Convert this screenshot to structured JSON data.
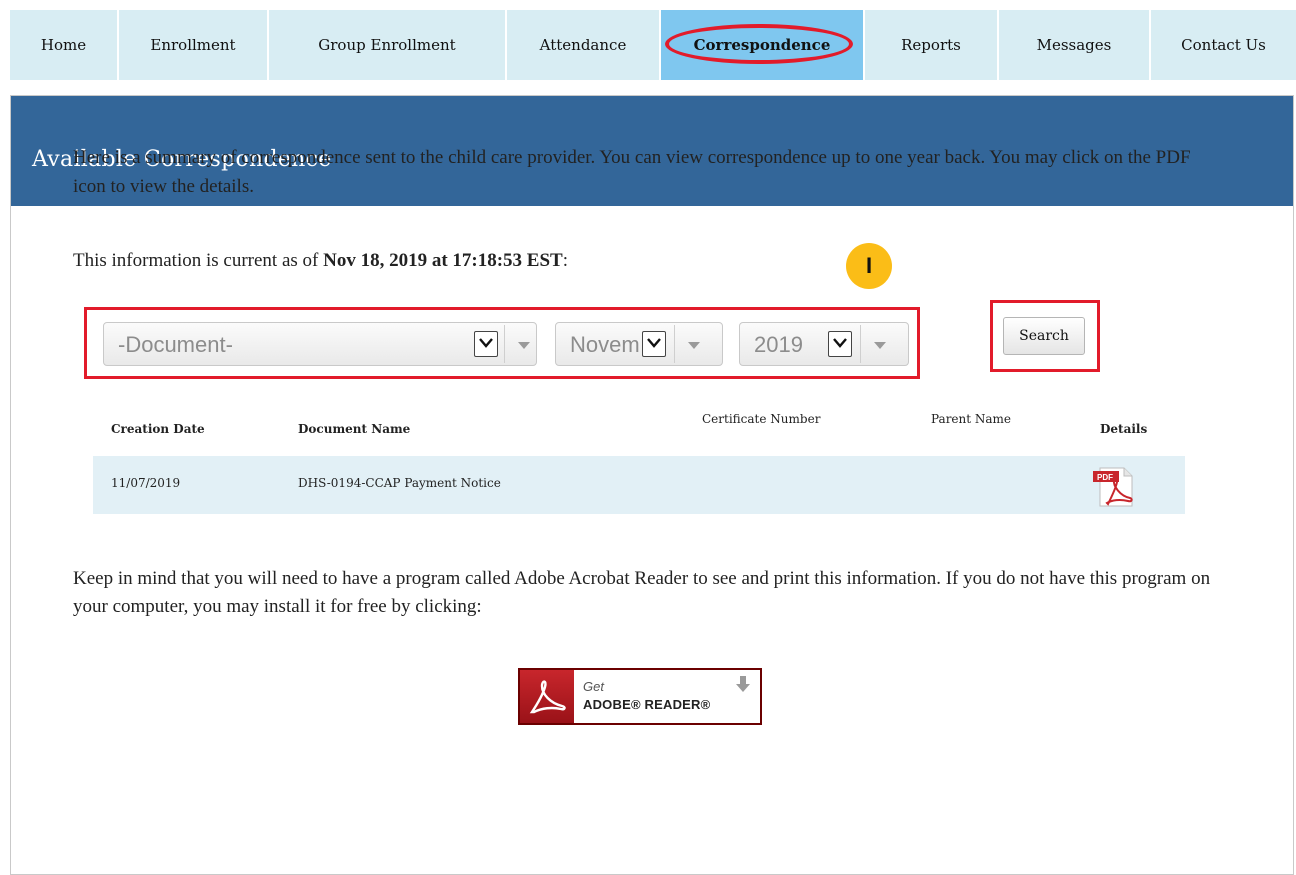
{
  "nav": {
    "items": [
      {
        "label": "Home"
      },
      {
        "label": "Enrollment"
      },
      {
        "label": "Group Enrollment"
      },
      {
        "label": "Attendance"
      },
      {
        "label": "Correspondence"
      },
      {
        "label": "Reports"
      },
      {
        "label": "Messages"
      },
      {
        "label": "Contact Us"
      }
    ],
    "active_index": 4
  },
  "panel": {
    "title": "Available Correspondence",
    "intro": "Here is a summary of correspondence sent to the child care provider. You can view correspondence up to one year back. You may click on the PDF icon to view the details.",
    "asof_prefix": "This information is current as of ",
    "asof_value": "Nov 18, 2019 at 17:18:53 EST",
    "asof_suffix": ":"
  },
  "badge": {
    "label": "I"
  },
  "filters": {
    "document": "-Document-",
    "month": "Novem",
    "year": "2019",
    "search_label": "Search"
  },
  "table": {
    "headers": {
      "creation_date": "Creation Date",
      "document_name": "Document Name",
      "certificate_number": "Certificate Number",
      "parent_name": "Parent Name",
      "details": "Details"
    },
    "rows": [
      {
        "creation_date": "11/07/2019",
        "document_name": "DHS-0194-CCAP Payment Notice",
        "certificate_number": "",
        "parent_name": "",
        "details_icon": "pdf-icon"
      }
    ]
  },
  "footer": {
    "note": "Keep in mind that you will need to have a program called Adobe Acrobat Reader to see and print this information. If you do not have this program on your computer, you may install it for free by clicking:",
    "adobe_get": "Get",
    "adobe_name": "ADOBE® READER®"
  },
  "colors": {
    "nav_bg": "#d8edf3",
    "nav_active": "#7fc7ef",
    "header_bg": "#336699",
    "highlight_red": "#e21b2a",
    "row_bg": "#e2f0f6",
    "badge": "#fbbd17"
  }
}
